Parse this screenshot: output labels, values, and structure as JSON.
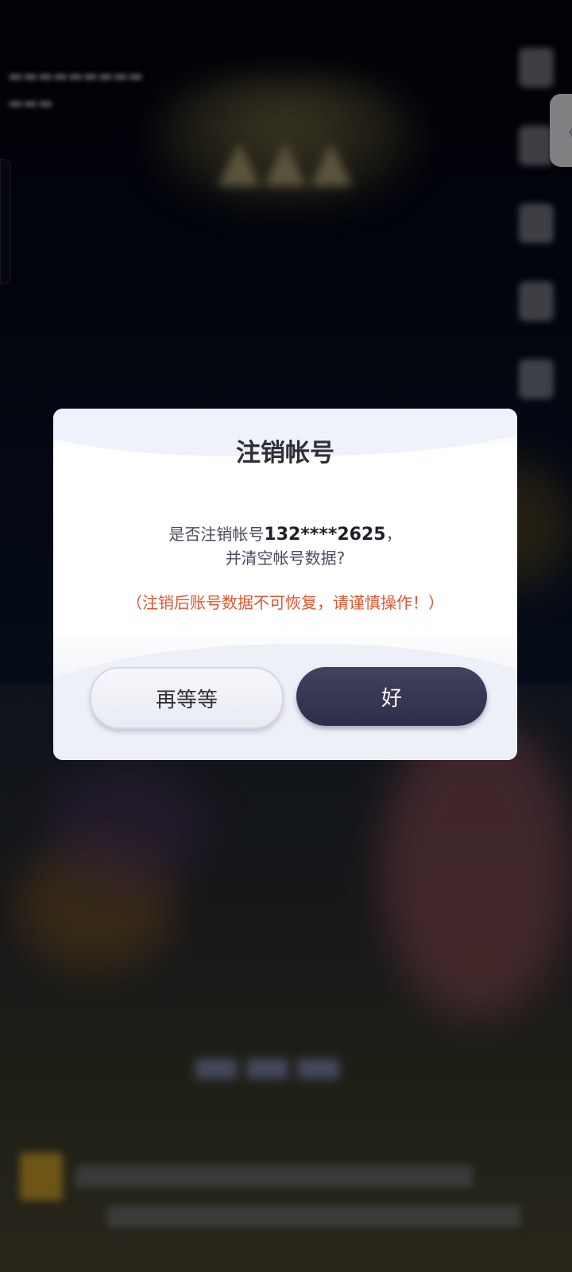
{
  "dialog": {
    "title": "注销帐号",
    "message_prefix": "是否注销帐号",
    "account_number": "132****2625",
    "message_suffix": "，",
    "message_line2": "并清空帐号数据?",
    "warning": "（注销后账号数据不可恢复，请谨慎操作！）",
    "cancel_label": "再等等",
    "confirm_label": "好"
  },
  "side_tab": {
    "icon": "chevron-left-icon",
    "glyph": "〈"
  },
  "colors": {
    "warning": "#e0562f",
    "confirm_button": "#34334e",
    "dialog_background": "#ffffff"
  }
}
